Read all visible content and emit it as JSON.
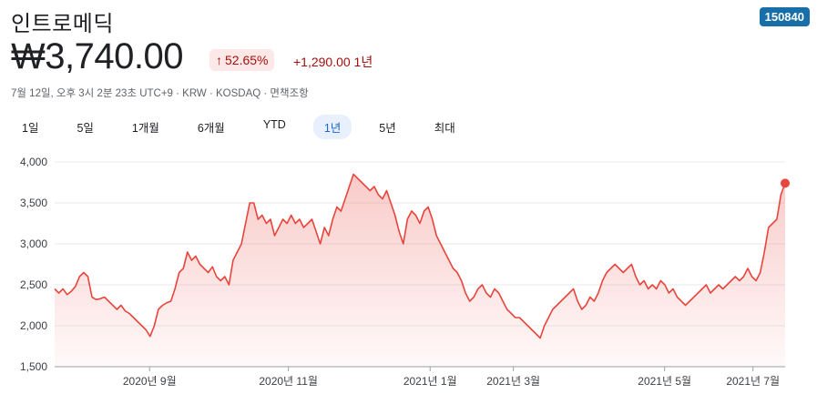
{
  "stock": {
    "name": "인트로메딕",
    "ticker": "150840",
    "price": "₩3,740.00",
    "change_pct": "52.65%",
    "change_arrow": "↑",
    "change_abs": "+1,290.00 1년",
    "meta": "7월 12일, 오후 3시 2분 23초 UTC+9 · KRW · KOSDAQ · 면책조항"
  },
  "tabs": [
    "1일",
    "5일",
    "1개월",
    "6개월",
    "YTD",
    "1년",
    "5년",
    "최대"
  ],
  "active_tab": "1년",
  "colors": {
    "line": "#e8453c",
    "accent": "#176ea8",
    "badge_bg": "#fce8e6",
    "badge_text": "#a50e0e"
  },
  "chart_data": {
    "type": "area",
    "title": "",
    "xlabel": "",
    "ylabel": "",
    "ylim": [
      1500,
      4000
    ],
    "yticks": [
      "4,000",
      "3,500",
      "3,000",
      "2,500",
      "2,000",
      "1,500"
    ],
    "ytick_values": [
      4000,
      3500,
      3000,
      2500,
      2000,
      1500
    ],
    "xlim": [
      0,
      100
    ],
    "xticks": [
      {
        "label": "2020년 9월",
        "pos": 13.0
      },
      {
        "label": "2020년 11월",
        "pos": 32.0
      },
      {
        "label": "2021년 1월",
        "pos": 51.4
      },
      {
        "label": "2021년 3월",
        "pos": 62.8
      },
      {
        "label": "2021년 5월",
        "pos": 83.5
      },
      {
        "label": "2021년 7월",
        "pos": 95.6
      }
    ],
    "grid": true,
    "series": [
      {
        "values": [
          2450,
          2400,
          2450,
          2380,
          2420,
          2480,
          2600,
          2650,
          2600,
          2350,
          2320,
          2330,
          2350,
          2300,
          2250,
          2200,
          2250,
          2180,
          2150,
          2100,
          2050,
          2000,
          1950,
          1870,
          2000,
          2200,
          2250,
          2280,
          2300,
          2450,
          2650,
          2700,
          2900,
          2800,
          2850,
          2750,
          2700,
          2650,
          2720,
          2600,
          2550,
          2600,
          2500,
          2800,
          2900,
          3000,
          3250,
          3500,
          3500,
          3300,
          3350,
          3250,
          3300,
          3100,
          3200,
          3300,
          3250,
          3350,
          3250,
          3300,
          3200,
          3250,
          3300,
          3150,
          3000,
          3200,
          3100,
          3300,
          3450,
          3400,
          3550,
          3700,
          3850,
          3800,
          3750,
          3700,
          3650,
          3700,
          3600,
          3550,
          3650,
          3500,
          3350,
          3150,
          3000,
          3300,
          3400,
          3350,
          3250,
          3400,
          3450,
          3300,
          3100,
          3000,
          2900,
          2800,
          2700,
          2650,
          2550,
          2400,
          2300,
          2350,
          2450,
          2500,
          2400,
          2350,
          2450,
          2400,
          2300,
          2200,
          2150,
          2100,
          2100,
          2050,
          2000,
          1950,
          1900,
          1850,
          2000,
          2100,
          2200,
          2250,
          2300,
          2350,
          2400,
          2450,
          2300,
          2200,
          2250,
          2350,
          2300,
          2400,
          2550,
          2650,
          2700,
          2750,
          2700,
          2650,
          2700,
          2750,
          2600,
          2500,
          2550,
          2450,
          2500,
          2450,
          2550,
          2500,
          2400,
          2450,
          2350,
          2300,
          2250,
          2300,
          2350,
          2400,
          2450,
          2500,
          2400,
          2450,
          2500,
          2450,
          2500,
          2550,
          2600,
          2550,
          2600,
          2700,
          2600,
          2550,
          2650,
          2900,
          3200,
          3250,
          3300,
          3600,
          3740
        ]
      }
    ]
  }
}
